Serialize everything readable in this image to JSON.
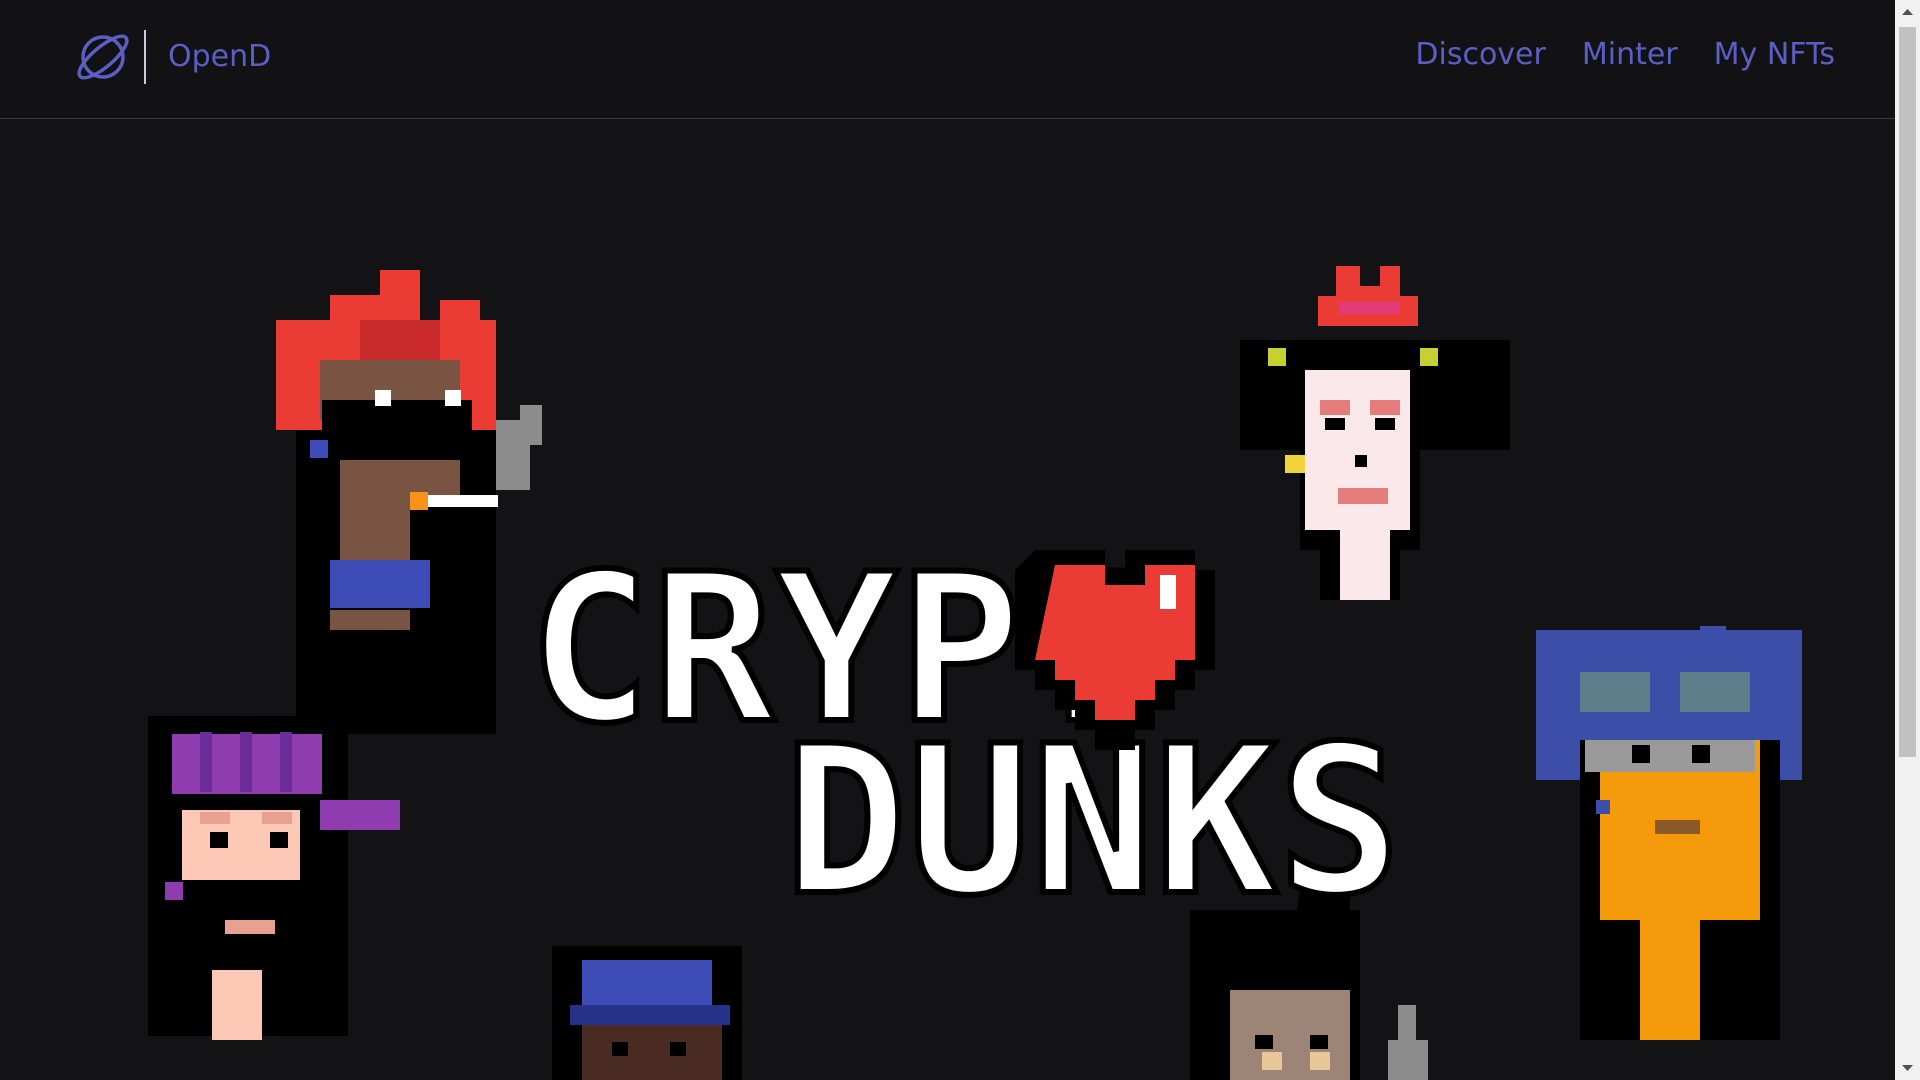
{
  "app": {
    "brand_name": "OpenD",
    "logo_icon": "planet-icon",
    "accent_color": "#5b5fc4",
    "background_color": "#131316"
  },
  "nav": {
    "links": [
      {
        "label": "Discover"
      },
      {
        "label": "Minter"
      },
      {
        "label": "My NFTs"
      }
    ]
  },
  "hero": {
    "logo_text_line1": "CRYPT",
    "logo_text_line2": "DUNKS",
    "logo_heart": "heart-icon",
    "characters": [
      "red-hair-punk-with-cigarette",
      "horned-woman-with-pigtails",
      "purple-cap-bearded-man",
      "blue-hair-orange-zombie",
      "blue-beanie-punk",
      "mohawk-punk-with-bottle"
    ]
  }
}
